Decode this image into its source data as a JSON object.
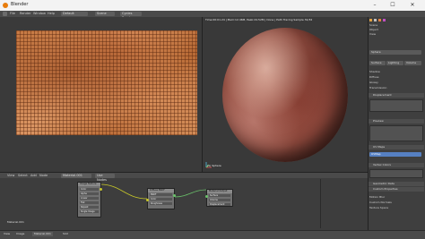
{
  "window": {
    "title": "Blender",
    "minimize": "–",
    "maximize": "☐",
    "close": "✕"
  },
  "menubar": {
    "items": [
      "File",
      "Render",
      "Window",
      "Help"
    ],
    "editor_button": "Default",
    "scene_button": "Scene",
    "engine_button": "Cycles Render"
  },
  "viewport": {
    "info": "Time:00:01.24 | Mem:12.46M, Peak:24.52M | Done | Path Tracing Sample 32/32",
    "object_label": "(1) Sphere"
  },
  "sidepanel": {
    "tabs": [
      "View",
      "Scene",
      "Object"
    ],
    "object_name": "Sphere",
    "material_tabs": [
      "Surface",
      "Lighting",
      "Volume"
    ],
    "sections": {
      "preview": "Preview",
      "surface": "Surface",
      "displacement": "Displacement",
      "settings": "Settings",
      "uv_maps": "UV Maps",
      "vertex_colors": "Vertex Colors",
      "geometry_data": "Geometric Data",
      "custom_properties": "Custom Properties"
    },
    "selected_uv": "UVMap",
    "labels": [
      "Shadow",
      "Diffuse",
      "Glossy",
      "Transmission",
      "Motion Blur",
      "Custom Normals",
      "Texture Space"
    ]
  },
  "node_editor": {
    "header_items": [
      "View",
      "Select",
      "Add",
      "Node"
    ],
    "material_field": "Material.001",
    "use_nodes": "Use Nodes",
    "nodes": {
      "image_texture": {
        "title": "Image Texture",
        "fields": [
          "Color",
          "Alpha",
          "Linear",
          "Flat",
          "Repeat",
          "Single Image"
        ]
      },
      "diffuse": {
        "title": "Diffuse BSDF",
        "fields": [
          "BSDF",
          "Color",
          "Roughness",
          "Normal"
        ]
      },
      "output": {
        "title": "Material Output",
        "fields": [
          "Surface",
          "Volume",
          "Displacement"
        ]
      }
    },
    "footer": "Material.001"
  },
  "statusbar": {
    "items": [
      "View",
      "Image",
      "Material.001",
      "Slot"
    ]
  }
}
